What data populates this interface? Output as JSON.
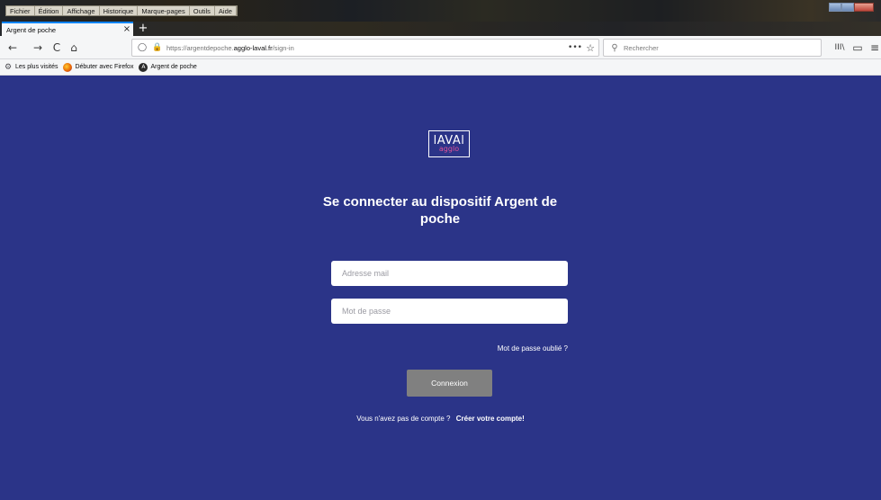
{
  "menu": {
    "items": [
      "Fichier",
      "Édition",
      "Affichage",
      "Historique",
      "Marque-pages",
      "Outils",
      "Aide"
    ]
  },
  "tab": {
    "title": "Argent de poche",
    "close_glyph": "×",
    "new_glyph": "+"
  },
  "toolbar": {
    "back_glyph": "←",
    "forward_glyph": "→",
    "reload_glyph": "C",
    "home_glyph": "⌂",
    "url_prefix": "https://argentdepoche.",
    "url_domain": "agglo-laval.fr",
    "url_path": "/sign-in",
    "more_glyph": "•••",
    "star_glyph": "☆",
    "library_glyph": "III\\",
    "sidebar_glyph": "▭",
    "menu_glyph": "≡"
  },
  "search": {
    "placeholder": "Rechercher"
  },
  "bookmarks": {
    "items": [
      {
        "label": "Les plus visités",
        "icon": "gear-icon"
      },
      {
        "label": "Débuter avec Firefox",
        "icon": "firefox-icon"
      },
      {
        "label": "Argent de poche",
        "icon": "angular-icon"
      }
    ]
  },
  "page": {
    "logo_main": "lAVAl",
    "logo_sub": "agglo",
    "heading": "Se connecter au dispositif Argent de poche",
    "email_placeholder": "Adresse mail",
    "password_placeholder": "Mot de passe",
    "forgot_label": "Mot de passe oublié ?",
    "submit_label": "Connexion",
    "signup_prompt": "Vous n'avez pas de compte ?",
    "signup_link": "Créer votre compte!"
  },
  "colors": {
    "page_background": "#2b3488",
    "logo_accent": "#e0529a",
    "button_background": "#808080",
    "tab_accent": "#0a84ff"
  }
}
